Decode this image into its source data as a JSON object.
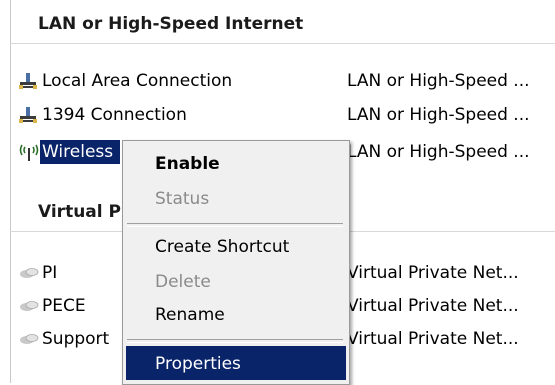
{
  "groups": {
    "lan": {
      "header": "LAN or High-Speed Internet"
    },
    "virtual": {
      "header": "Virtual Private Network"
    }
  },
  "connections": [
    {
      "name": "Local Area Connection",
      "type": "LAN or High-Speed ...",
      "icon": "lan-icon"
    },
    {
      "name": "1394 Connection",
      "type": "LAN or High-Speed ...",
      "icon": "lan-icon"
    },
    {
      "name": "Wireless Network Connection",
      "type": "LAN or High-Speed ...",
      "icon": "wireless-icon",
      "selected": true
    },
    {
      "name": "PI",
      "type": "Virtual Private Net...",
      "icon": "vpn-icon"
    },
    {
      "name": "PECE",
      "type": "Virtual Private Net...",
      "icon": "vpn-icon"
    },
    {
      "name": "Support",
      "type": "Virtual Private Net...",
      "icon": "vpn-icon"
    }
  ],
  "context_menu": {
    "items": [
      {
        "label": "Enable",
        "bold": true
      },
      {
        "label": "Status",
        "disabled": true
      },
      {
        "label": "Create Shortcut"
      },
      {
        "label": "Delete",
        "disabled": true
      },
      {
        "label": "Rename"
      },
      {
        "label": "Properties",
        "highlighted": true
      }
    ]
  },
  "colors": {
    "selection": "#0a246a",
    "menu_bg": "#f0f0f0",
    "disabled_text": "#8a8a8a"
  }
}
